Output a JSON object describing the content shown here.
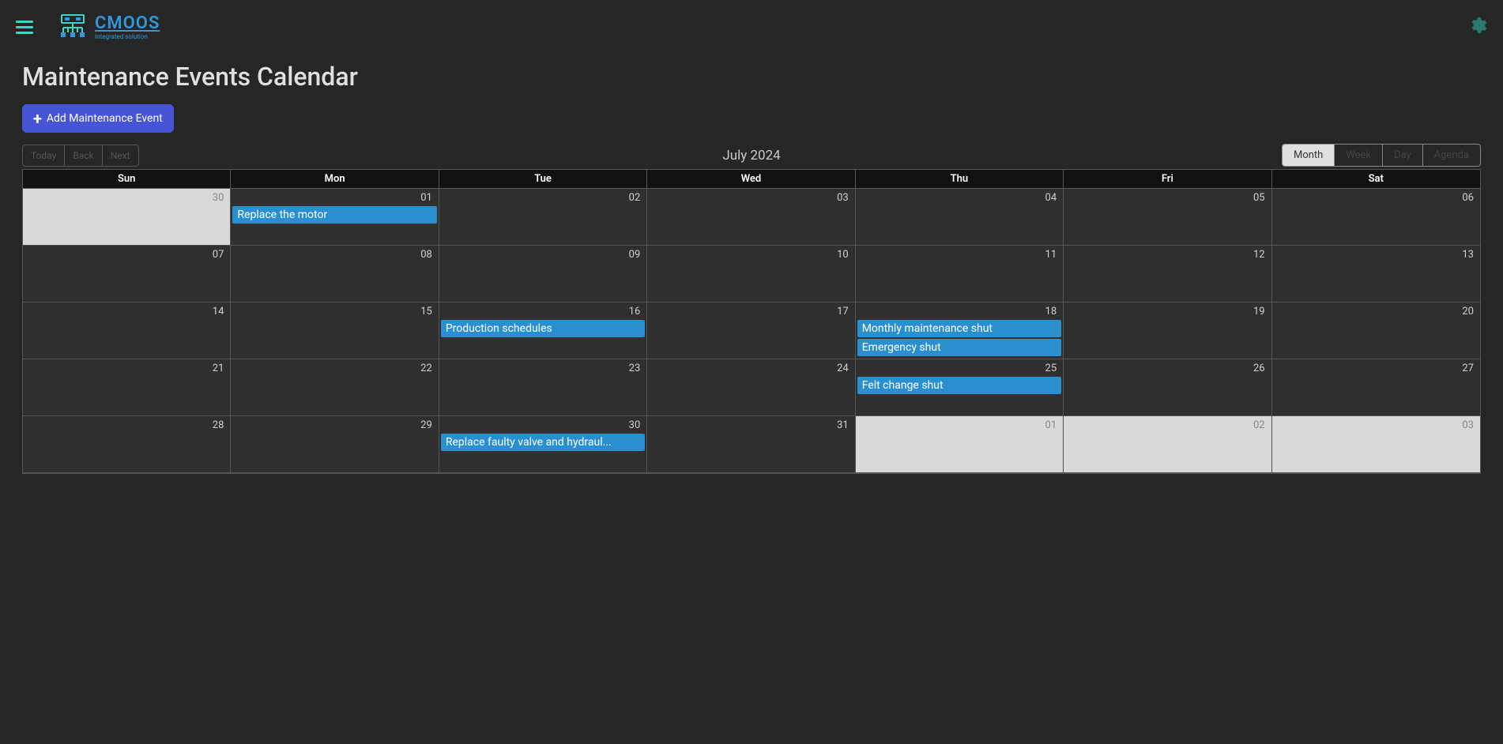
{
  "app": {
    "name": "CMOOS",
    "subtitle": "Integrated solution"
  },
  "page": {
    "title": "Maintenance Events Calendar",
    "addButton": "Add Maintenance Event"
  },
  "toolbar": {
    "nav": [
      "Today",
      "Back",
      "Next"
    ],
    "monthLabel": "July 2024",
    "views": [
      "Month",
      "Week",
      "Day",
      "Agenda"
    ],
    "activeView": "Month"
  },
  "calendar": {
    "dayHeaders": [
      "Sun",
      "Mon",
      "Tue",
      "Wed",
      "Thu",
      "Fri",
      "Sat"
    ],
    "weeks": [
      [
        {
          "day": "30",
          "other": true,
          "events": []
        },
        {
          "day": "01",
          "events": [
            "Replace the motor"
          ]
        },
        {
          "day": "02",
          "events": []
        },
        {
          "day": "03",
          "events": []
        },
        {
          "day": "04",
          "events": []
        },
        {
          "day": "05",
          "events": []
        },
        {
          "day": "06",
          "events": []
        }
      ],
      [
        {
          "day": "07",
          "events": []
        },
        {
          "day": "08",
          "events": []
        },
        {
          "day": "09",
          "events": []
        },
        {
          "day": "10",
          "events": []
        },
        {
          "day": "11",
          "events": []
        },
        {
          "day": "12",
          "events": []
        },
        {
          "day": "13",
          "events": []
        }
      ],
      [
        {
          "day": "14",
          "events": []
        },
        {
          "day": "15",
          "events": []
        },
        {
          "day": "16",
          "events": [
            "Production schedules"
          ]
        },
        {
          "day": "17",
          "events": []
        },
        {
          "day": "18",
          "events": [
            "Monthly maintenance shut",
            "Emergency shut"
          ]
        },
        {
          "day": "19",
          "events": []
        },
        {
          "day": "20",
          "events": []
        }
      ],
      [
        {
          "day": "21",
          "events": []
        },
        {
          "day": "22",
          "events": []
        },
        {
          "day": "23",
          "events": []
        },
        {
          "day": "24",
          "events": []
        },
        {
          "day": "25",
          "events": [
            "Felt change shut"
          ]
        },
        {
          "day": "26",
          "events": []
        },
        {
          "day": "27",
          "events": []
        }
      ],
      [
        {
          "day": "28",
          "events": []
        },
        {
          "day": "29",
          "events": []
        },
        {
          "day": "30",
          "events": [
            "Replace faulty valve and hydraul..."
          ]
        },
        {
          "day": "31",
          "events": []
        },
        {
          "day": "01",
          "other": true,
          "events": []
        },
        {
          "day": "02",
          "other": true,
          "events": []
        },
        {
          "day": "03",
          "other": true,
          "events": []
        }
      ]
    ]
  }
}
